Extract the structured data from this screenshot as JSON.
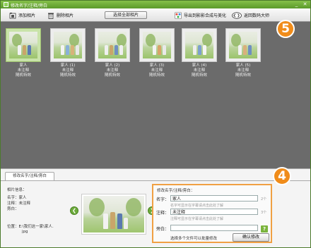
{
  "window": {
    "title": "修改名字/注释/旁白"
  },
  "toolbar": {
    "add_photos": "添加相片",
    "delete_photos": "删除相片",
    "select_all": "选择全部相片",
    "export": "导出到影影合成与美化",
    "back": "返回数码大师"
  },
  "badges": {
    "gallery": "5",
    "editor": "4"
  },
  "thumbnails": [
    {
      "name": "家人",
      "note": "未注释",
      "effect": "随机特效",
      "selected": true
    },
    {
      "name": "家人 (1)",
      "note": "未注释",
      "effect": "随机特效",
      "selected": false
    },
    {
      "name": "家人 (2)",
      "note": "未注释",
      "effect": "随机特效",
      "selected": false
    },
    {
      "name": "家人 (3)",
      "note": "未注释",
      "effect": "随机特效",
      "selected": false
    },
    {
      "name": "家人 (4)",
      "note": "未注释",
      "effect": "随机特效",
      "selected": false
    },
    {
      "name": "家人 (5)",
      "note": "未注释",
      "effect": "随机特效",
      "selected": false
    }
  ],
  "editor": {
    "tab": "修改名字/注释/旁白",
    "info": {
      "heading": "相片信息：",
      "name": "名字：家人",
      "note": "注释：未注释",
      "narration": "旁白：",
      "location_line1": "位置：E:\\我们这一家\\家人.",
      "location_line2": "jpg"
    },
    "form": {
      "title": "修改名字/注释/旁白：",
      "name_label": "名字：",
      "name_value": "家人",
      "name_count": "2个",
      "name_hint": "名字可显示在字幕请点击此处了解",
      "note_label": "注释：",
      "note_value": "未注释",
      "note_count": "3个",
      "note_hint": "注释可显示在字幕请点击此处了解",
      "narration_label": "旁白：",
      "narration_value": "",
      "help": "?",
      "batch_hint": "选择多个文件可以批量修改",
      "confirm": "确认修改"
    }
  },
  "colors": {
    "titlebar": "#6faa38",
    "badge": "#f08c1a",
    "highlight_border": "#f0a043"
  }
}
